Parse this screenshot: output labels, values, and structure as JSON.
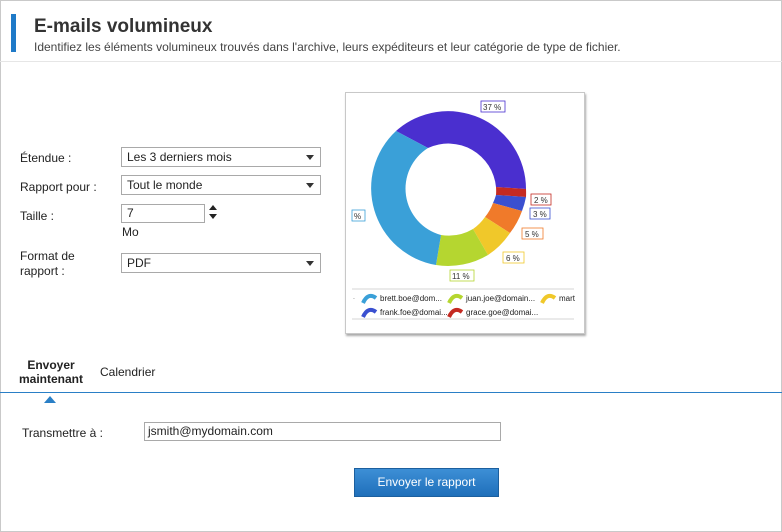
{
  "header": {
    "title": "E-mails volumineux",
    "subtitle": "Identifiez les éléments volumineux trouvés dans l'archive, leurs expéditeurs et leur catégorie de type de fichier."
  },
  "form": {
    "range_label": "Étendue :",
    "range_value": "Les 3 derniers mois",
    "report_for_label": "Rapport pour :",
    "report_for_value": "Tout le monde",
    "size_label": "Taille :",
    "size_value": "7",
    "size_unit": "Mo",
    "format_label_line1": "Format de",
    "format_label_line2": "rapport :",
    "format_value": "PDF"
  },
  "tabs": {
    "send_now_line1": "Envoyer",
    "send_now_line2": "maintenant",
    "schedule": "Calendrier"
  },
  "send": {
    "recipient_label": "Transmettre à :",
    "recipient_value": "jsmith@mydomain.com",
    "submit_label": "Envoyer le rapport"
  },
  "colors": {
    "accent": "#1f7ac8",
    "button": "#2a7fc6"
  },
  "chart_data": {
    "type": "pie",
    "donut": true,
    "labels": [
      "37 %",
      "2 %",
      "3 %",
      "5 %",
      "6 %",
      "11 %",
      "%"
    ],
    "series": [
      {
        "name": "brett.boe@dom...",
        "color": "#3aa0d8"
      },
      {
        "name": "juan.joe@domain...",
        "color": "#b5d630"
      },
      {
        "name": "mart",
        "color": "#f0c82a"
      },
      {
        "name": "frank.foe@domai...",
        "color": "#3a50d0"
      },
      {
        "name": "grace.goe@domai...",
        "color": "#c42a22"
      }
    ],
    "legend": "bottom"
  }
}
